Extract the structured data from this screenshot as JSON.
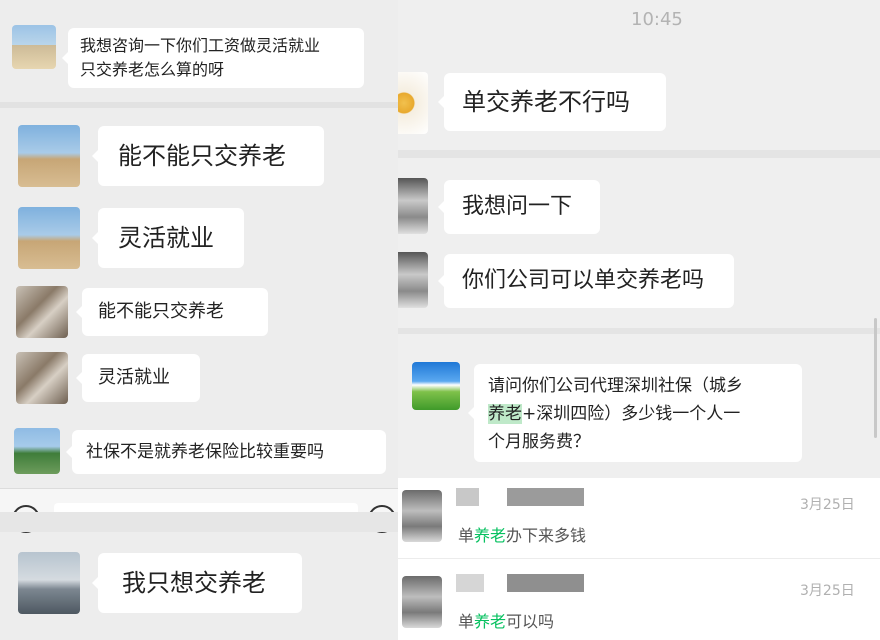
{
  "left_panel": {
    "messages": [
      {
        "text_line1": "我想咨询一下你们工资做灵活就业",
        "text_line2": "只交养老怎么算的呀"
      },
      {
        "text": "能不能只交养老"
      },
      {
        "text": "灵活就业"
      },
      {
        "text": "能不能只交养老"
      },
      {
        "text": "灵活就业"
      },
      {
        "text": "社保不是就养老保险比较重要吗"
      },
      {
        "text": "我只想交养老"
      }
    ]
  },
  "right_panel": {
    "time": "10:45",
    "messages": [
      {
        "text": "单交养老不行吗"
      },
      {
        "text": "我想问一下"
      },
      {
        "text": "你们公司可以单交养老吗"
      },
      {
        "line1": "请问你们公司代理深圳社保（城乡",
        "line2_highlight": "养老",
        "line2_rest": "+深圳四险）多少钱一个人一",
        "line3": "个月服务费？"
      }
    ],
    "comments": [
      {
        "date": "3月25日",
        "prefix": "单",
        "keyword": "养老",
        "suffix": "办下来多钱"
      },
      {
        "date": "3月25日",
        "prefix": "单",
        "keyword": "养老",
        "suffix": "可以吗"
      }
    ]
  }
}
